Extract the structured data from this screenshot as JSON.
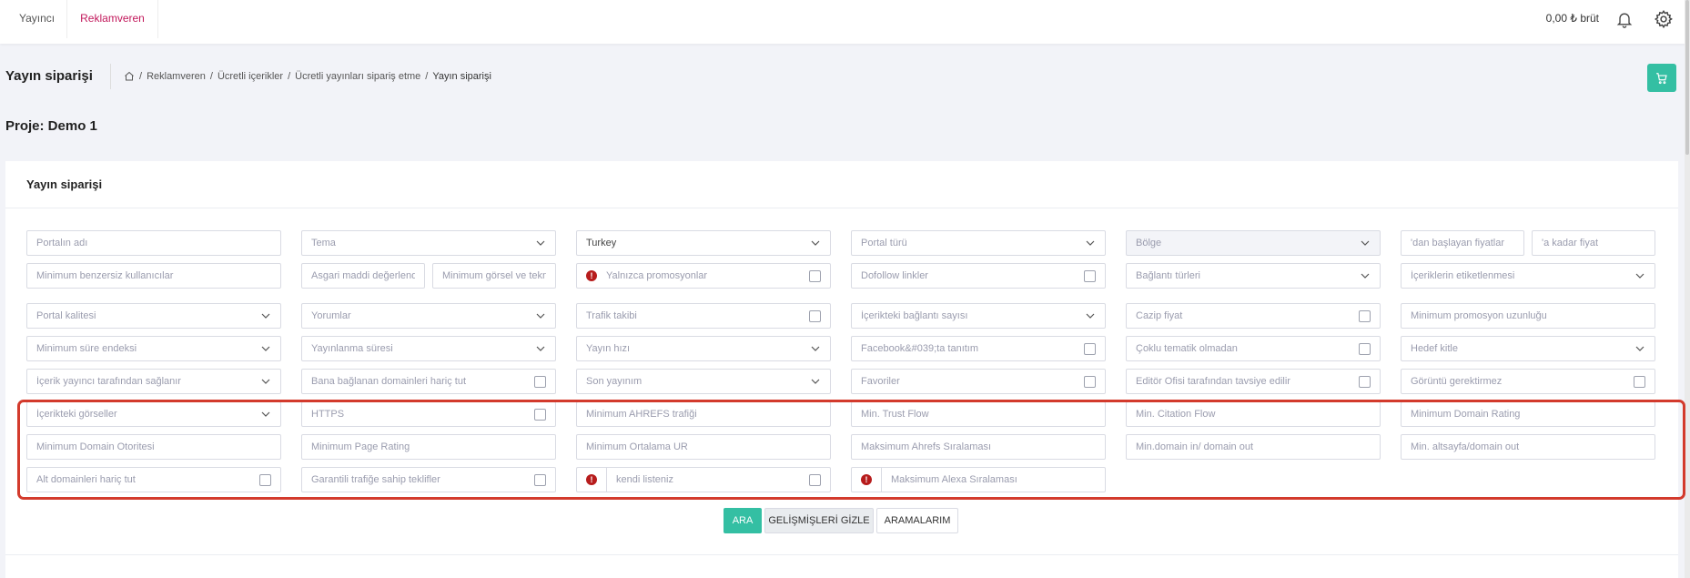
{
  "topbar": {
    "tabs": [
      {
        "label": "Yayıncı"
      },
      {
        "label": "Reklamveren"
      }
    ],
    "balance": "0,00 ₺ brüt"
  },
  "header": {
    "title": "Yayın siparişi",
    "breadcrumb": [
      "Reklamveren",
      "Ücretli içerikler",
      "Ücretli yayınları sipariş etme",
      "Yayın siparişi"
    ]
  },
  "project": "Proje: Demo 1",
  "card": {
    "title": "Yayın siparişi"
  },
  "fields": {
    "portal_name": "Portalın adı",
    "theme": "Tema",
    "country": "Turkey",
    "portal_type": "Portal türü",
    "region": "Bölge",
    "price_from": "'dan başlayan fiyatlar",
    "price_to": "'a kadar fiyat",
    "min_unique_users": "Minimum benzersiz kullanıcılar",
    "min_material": "Asgari maddi değerlendi",
    "min_visual": "Minimum görsel ve tekni",
    "only_promotions": "Yalnızca promosyonlar",
    "dofollow_links": "Dofollow linkler",
    "link_types": "Bağlantı türleri",
    "content_tagging": "İçeriklerin etiketlenmesi",
    "portal_quality": "Portal kalitesi",
    "comments": "Yorumlar",
    "traffic_tracking": "Trafik takibi",
    "links_in_content": "İçerikteki bağlantı sayısı",
    "attractive_price": "Cazip fiyat",
    "min_promo_length": "Minimum promosyon uzunluğu",
    "min_duration_index": "Minimum süre endeksi",
    "publish_duration": "Yayınlanma süresi",
    "publish_speed": "Yayın hızı",
    "facebook_promo": "Facebook&#039;ta tanıtım",
    "multi_thematic": "Çoklu tematik olmadan",
    "target_group": "Hedef kitle",
    "content_by_publisher": "İçerik yayıncı tarafından sağlanır",
    "exclude_linked_domains": "Bana bağlanan domainleri hariç tut",
    "last_publication": "Son yayınım",
    "favorites": "Favoriler",
    "editor_recommended": "Editör Ofisi tarafından tavsiye edilir",
    "no_image_required": "Görüntü gerektirmez",
    "content_images": "İçerikteki görseller",
    "https": "HTTPS",
    "min_ahrefs_traffic": "Minimum AHREFS trafiği",
    "min_trust_flow": "Min. Trust Flow",
    "min_citation_flow": "Min. Citation Flow",
    "min_domain_rating": "Minimum Domain Rating",
    "min_domain_authority": "Minimum Domain Otoritesi",
    "min_page_rating": "Minimum Page Rating",
    "min_avg_ur": "Minimum Ortalama UR",
    "max_ahrefs_rank": "Maksimum Ahrefs Sıralaması",
    "min_domain_in_out": "Min.domain in/ domain out",
    "min_subpage_domain_out": "Min. altsayfa/domain out",
    "exclude_subdomains": "Alt domainleri hariç tut",
    "guaranteed_traffic": "Garantili trafiğe sahip teklifler",
    "own_list": "kendi listeniz",
    "max_alexa_rank": "Maksimum Alexa Sıralaması"
  },
  "buttons": {
    "search": "ARA",
    "hide_advanced": "GELİŞMİŞLERİ GİZLE",
    "my_searches": "ARAMALARIM"
  },
  "colors": {
    "accent": "#34bfa3",
    "active_tab": "#c2185b",
    "highlight": "#d33a2c",
    "warning": "#b71c1c"
  }
}
